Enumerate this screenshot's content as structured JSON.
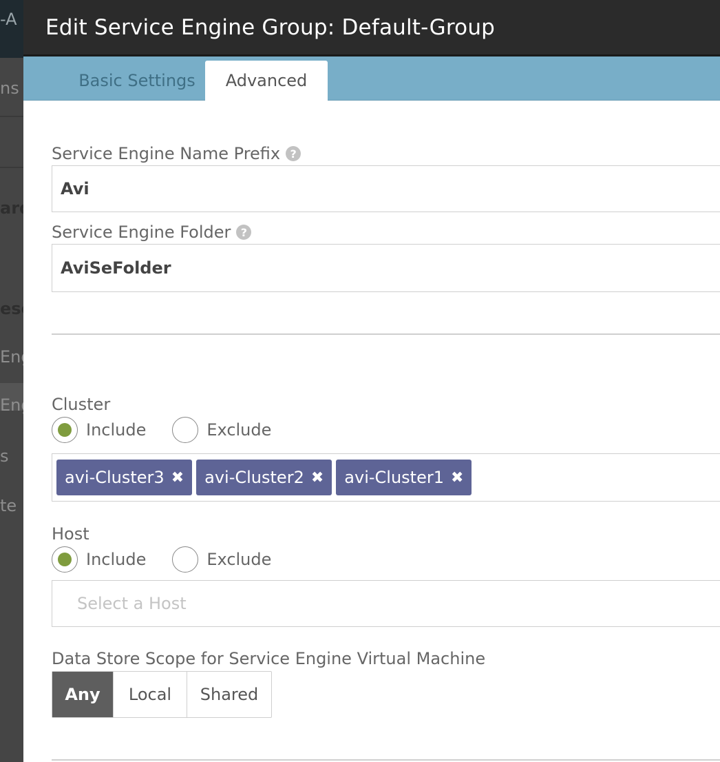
{
  "background": {
    "fragments": [
      "-A",
      "ns",
      "ard",
      "esc",
      "Eng",
      "Eng",
      "s",
      "te"
    ]
  },
  "modal": {
    "title": "Edit Service Engine Group: Default-Group",
    "tabs": [
      {
        "label": "Basic Settings",
        "active": false
      },
      {
        "label": "Advanced",
        "active": true
      }
    ]
  },
  "form": {
    "name_prefix": {
      "label": "Service Engine Name Prefix",
      "help": "?",
      "value": "Avi"
    },
    "folder": {
      "label": "Service Engine Folder",
      "help": "?",
      "value": "AviSeFolder"
    },
    "cluster": {
      "label": "Cluster",
      "include_label": "Include",
      "exclude_label": "Exclude",
      "selected": "Include",
      "tags": [
        "avi-Cluster3",
        "avi-Cluster2",
        "avi-Cluster1"
      ],
      "remove_glyph": "✖"
    },
    "host": {
      "label": "Host",
      "include_label": "Include",
      "exclude_label": "Exclude",
      "selected": "Include",
      "placeholder": "Select a Host"
    },
    "datastore": {
      "label": "Data Store Scope for Service Engine Virtual Machine",
      "options": [
        "Any",
        "Local",
        "Shared"
      ],
      "selected": "Any"
    }
  },
  "colors": {
    "header_bg": "#2b2b2b",
    "tabbar_bg": "#78aec8",
    "tag_bg": "#5e6496",
    "radio_on": "#7f9c3e",
    "segment_active": "#5e5e5e"
  }
}
